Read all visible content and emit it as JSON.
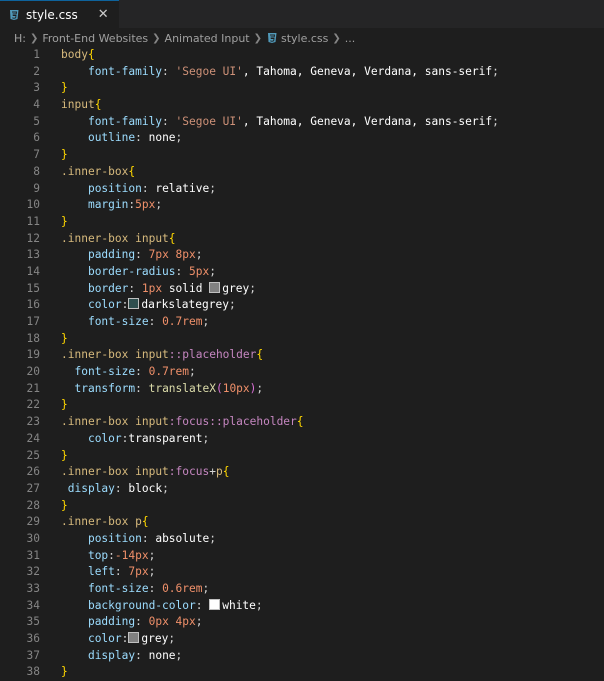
{
  "tab": {
    "filename": "style.css",
    "close_glyph": "✕"
  },
  "breadcrumb": {
    "items": [
      "H:",
      "Front-End Websites",
      "Animated Input",
      "style.css",
      "..."
    ]
  },
  "swatches": {
    "grey": "#808080",
    "darkslategrey": "#2f4f4f",
    "white": "#ffffff"
  },
  "code_lines": [
    [
      [
        "tag",
        "body"
      ],
      [
        "brace",
        "{"
      ]
    ],
    [
      [
        "ind",
        "    "
      ],
      [
        "prop",
        "font-family"
      ],
      [
        "punc",
        ": "
      ],
      [
        "str",
        "'Segoe UI'"
      ],
      [
        "val",
        ", Tahoma, Geneva, Verdana, sans-serif"
      ],
      [
        "punc",
        ";"
      ]
    ],
    [
      [
        "brace",
        "}"
      ]
    ],
    [
      [
        "tag",
        "input"
      ],
      [
        "brace",
        "{"
      ]
    ],
    [
      [
        "ind",
        "    "
      ],
      [
        "prop",
        "font-family"
      ],
      [
        "punc",
        ": "
      ],
      [
        "str",
        "'Segoe UI'"
      ],
      [
        "val",
        ", Tahoma, Geneva, Verdana, sans-serif"
      ],
      [
        "punc",
        ";"
      ]
    ],
    [
      [
        "ind",
        "    "
      ],
      [
        "prop",
        "outline"
      ],
      [
        "punc",
        ": "
      ],
      [
        "val",
        "none"
      ],
      [
        "punc",
        ";"
      ]
    ],
    [
      [
        "brace",
        "}"
      ]
    ],
    [
      [
        "cls",
        ".inner-box"
      ],
      [
        "brace",
        "{"
      ]
    ],
    [
      [
        "ind",
        "    "
      ],
      [
        "prop",
        "position"
      ],
      [
        "punc",
        ": "
      ],
      [
        "val",
        "relative"
      ],
      [
        "punc",
        ";"
      ]
    ],
    [
      [
        "ind",
        "    "
      ],
      [
        "prop",
        "margin"
      ],
      [
        "punc",
        ":"
      ],
      [
        "num",
        "5px"
      ],
      [
        "punc",
        ";"
      ]
    ],
    [
      [
        "brace",
        "}"
      ]
    ],
    [
      [
        "cls",
        ".inner-box"
      ],
      [
        "punc",
        " "
      ],
      [
        "tag",
        "input"
      ],
      [
        "brace",
        "{"
      ]
    ],
    [
      [
        "ind",
        "    "
      ],
      [
        "prop",
        "padding"
      ],
      [
        "punc",
        ": "
      ],
      [
        "num",
        "7px 8px"
      ],
      [
        "punc",
        ";"
      ]
    ],
    [
      [
        "ind",
        "    "
      ],
      [
        "prop",
        "border-radius"
      ],
      [
        "punc",
        ": "
      ],
      [
        "num",
        "5px"
      ],
      [
        "punc",
        ";"
      ]
    ],
    [
      [
        "ind",
        "    "
      ],
      [
        "prop",
        "border"
      ],
      [
        "punc",
        ": "
      ],
      [
        "num",
        "1px"
      ],
      [
        "val",
        " solid "
      ],
      [
        "swatch",
        "grey"
      ],
      [
        "val",
        "grey"
      ],
      [
        "punc",
        ";"
      ]
    ],
    [
      [
        "ind",
        "    "
      ],
      [
        "prop",
        "color"
      ],
      [
        "punc",
        ":"
      ],
      [
        "swatch",
        "darkslategrey"
      ],
      [
        "val",
        "darkslategrey"
      ],
      [
        "punc",
        ";"
      ]
    ],
    [
      [
        "ind",
        "    "
      ],
      [
        "prop",
        "font-size"
      ],
      [
        "punc",
        ": "
      ],
      [
        "num",
        "0.7rem"
      ],
      [
        "punc",
        ";"
      ]
    ],
    [
      [
        "brace",
        "}"
      ]
    ],
    [
      [
        "cls",
        ".inner-box"
      ],
      [
        "punc",
        " "
      ],
      [
        "tag",
        "input"
      ],
      [
        "pseudo",
        "::placeholder"
      ],
      [
        "brace",
        "{"
      ]
    ],
    [
      [
        "ind",
        "  "
      ],
      [
        "prop",
        "font-size"
      ],
      [
        "punc",
        ": "
      ],
      [
        "num",
        "0.7rem"
      ],
      [
        "punc",
        ";"
      ]
    ],
    [
      [
        "ind",
        "  "
      ],
      [
        "prop",
        "transform"
      ],
      [
        "punc",
        ": "
      ],
      [
        "fn",
        "translateX"
      ],
      [
        "paren",
        "("
      ],
      [
        "num",
        "10px"
      ],
      [
        "paren",
        ")"
      ],
      [
        "punc",
        ";"
      ]
    ],
    [
      [
        "brace",
        "}"
      ]
    ],
    [
      [
        "cls",
        ".inner-box"
      ],
      [
        "punc",
        " "
      ],
      [
        "tag",
        "input"
      ],
      [
        "pseudo",
        ":focus::placeholder"
      ],
      [
        "brace",
        "{"
      ]
    ],
    [
      [
        "ind",
        "    "
      ],
      [
        "prop",
        "color"
      ],
      [
        "punc",
        ":"
      ],
      [
        "val",
        "transparent"
      ],
      [
        "punc",
        ";"
      ]
    ],
    [
      [
        "brace",
        "}"
      ]
    ],
    [
      [
        "cls",
        ".inner-box"
      ],
      [
        "punc",
        " "
      ],
      [
        "tag",
        "input"
      ],
      [
        "pseudo",
        ":focus"
      ],
      [
        "punc",
        "+"
      ],
      [
        "tag",
        "p"
      ],
      [
        "brace",
        "{"
      ]
    ],
    [
      [
        "ind",
        " "
      ],
      [
        "prop",
        "display"
      ],
      [
        "punc",
        ": "
      ],
      [
        "val",
        "block"
      ],
      [
        "punc",
        ";"
      ]
    ],
    [
      [
        "brace",
        "}"
      ]
    ],
    [
      [
        "cls",
        ".inner-box"
      ],
      [
        "punc",
        " "
      ],
      [
        "tag",
        "p"
      ],
      [
        "brace",
        "{"
      ]
    ],
    [
      [
        "ind",
        "    "
      ],
      [
        "prop",
        "position"
      ],
      [
        "punc",
        ": "
      ],
      [
        "val",
        "absolute"
      ],
      [
        "punc",
        ";"
      ]
    ],
    [
      [
        "ind",
        "    "
      ],
      [
        "prop",
        "top"
      ],
      [
        "punc",
        ":"
      ],
      [
        "num",
        "-14px"
      ],
      [
        "punc",
        ";"
      ]
    ],
    [
      [
        "ind",
        "    "
      ],
      [
        "prop",
        "left"
      ],
      [
        "punc",
        ": "
      ],
      [
        "num",
        "7px"
      ],
      [
        "punc",
        ";"
      ]
    ],
    [
      [
        "ind",
        "    "
      ],
      [
        "prop",
        "font-size"
      ],
      [
        "punc",
        ": "
      ],
      [
        "num",
        "0.6rem"
      ],
      [
        "punc",
        ";"
      ]
    ],
    [
      [
        "ind",
        "    "
      ],
      [
        "prop",
        "background-color"
      ],
      [
        "punc",
        ": "
      ],
      [
        "swatch",
        "white"
      ],
      [
        "val",
        "white"
      ],
      [
        "punc",
        ";"
      ]
    ],
    [
      [
        "ind",
        "    "
      ],
      [
        "prop",
        "padding"
      ],
      [
        "punc",
        ": "
      ],
      [
        "num",
        "0px 4px"
      ],
      [
        "punc",
        ";"
      ]
    ],
    [
      [
        "ind",
        "    "
      ],
      [
        "prop",
        "color"
      ],
      [
        "punc",
        ":"
      ],
      [
        "swatch",
        "grey"
      ],
      [
        "val",
        "grey"
      ],
      [
        "punc",
        ";"
      ]
    ],
    [
      [
        "ind",
        "    "
      ],
      [
        "prop",
        "display"
      ],
      [
        "punc",
        ": "
      ],
      [
        "val",
        "none"
      ],
      [
        "punc",
        ";"
      ]
    ],
    [
      [
        "brace",
        "}"
      ]
    ]
  ]
}
